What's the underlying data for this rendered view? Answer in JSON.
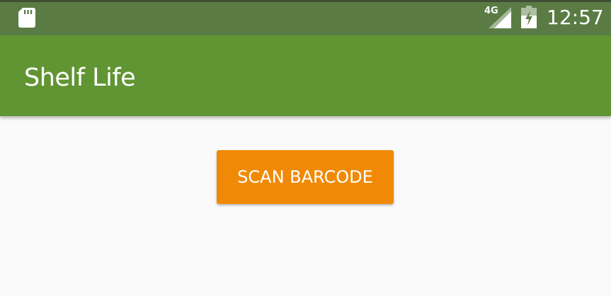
{
  "status_bar": {
    "network_type": "4G",
    "time": "12:57",
    "icons": [
      "sd-card-icon",
      "cellular-signal-icon",
      "battery-charging-icon"
    ]
  },
  "app_bar": {
    "title": "Shelf Life"
  },
  "main": {
    "scan_button_label": "SCAN BARCODE"
  },
  "colors": {
    "status_bar": "#5a7c44",
    "app_bar": "#619533",
    "scan_button": "#f08a06",
    "background": "#fafafa"
  }
}
